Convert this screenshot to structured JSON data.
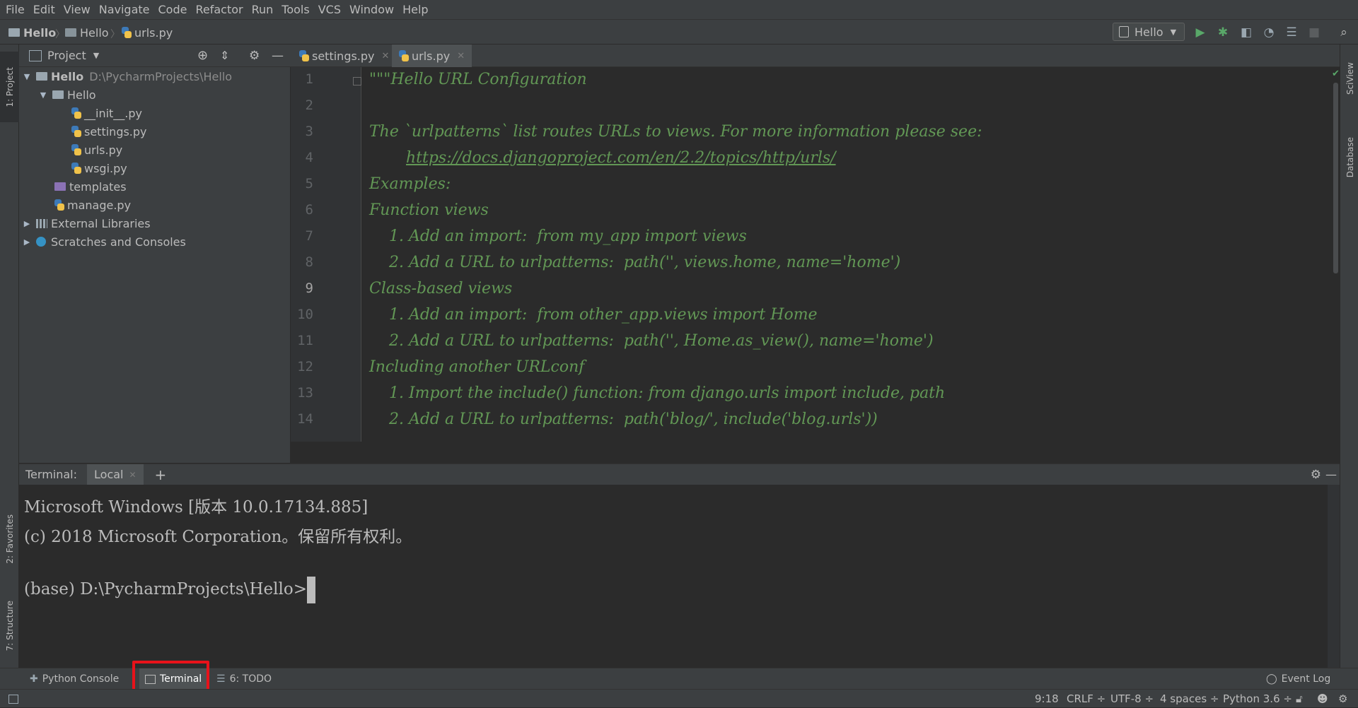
{
  "menu": [
    "File",
    "Edit",
    "View",
    "Navigate",
    "Code",
    "Refactor",
    "Run",
    "Tools",
    "VCS",
    "Window",
    "Help"
  ],
  "breadcrumb": {
    "project": "Hello",
    "folder": "Hello",
    "file": "urls.py"
  },
  "toolbar": {
    "run_config": "Hello"
  },
  "left_stripe": {
    "project": "1: Project",
    "favorites": "2: Favorites",
    "structure": "7: Structure"
  },
  "right_stripe": {
    "sciview": "SciView",
    "database": "Database"
  },
  "project_panel": {
    "title": "Project",
    "root": {
      "name": "Hello",
      "path": "D:\\PycharmProjects\\Hello"
    },
    "package": "Hello",
    "files": [
      "__init__.py",
      "settings.py",
      "urls.py",
      "wsgi.py"
    ],
    "templates": "templates",
    "manage": "manage.py",
    "external": "External Libraries",
    "scratches": "Scratches and Consoles"
  },
  "editor": {
    "tabs": [
      {
        "label": "settings.py"
      },
      {
        "label": "urls.py"
      }
    ],
    "line_numbers": [
      "1",
      "2",
      "3",
      "4",
      "5",
      "6",
      "7",
      "8",
      "9",
      "10",
      "11",
      "12",
      "13",
      "14"
    ],
    "lines": [
      "\"\"\"Hello URL Configuration",
      "",
      "The `urlpatterns` list routes URLs to views. For more information please see:",
      "https://docs.djangoproject.com/en/2.2/topics/http/urls/",
      "Examples:",
      "Function views",
      "    1. Add an import:  from my_app import views",
      "    2. Add a URL to urlpatterns:  path('', views.home, name='home')",
      "Class-based views",
      "    1. Add an import:  from other_app.views import Home",
      "    2. Add a URL to urlpatterns:  path('', Home.as_view(), name='home')",
      "Including another URLconf",
      "    1. Import the include() function: from django.urls import include, path",
      "    2. Add a URL to urlpatterns:  path('blog/', include('blog.urls'))"
    ]
  },
  "terminal": {
    "label": "Terminal:",
    "tab": "Local",
    "lines": [
      "Microsoft Windows [版本 10.0.17134.885]",
      "(c) 2018 Microsoft Corporation。保留所有权利。",
      ""
    ],
    "prompt": "(base) D:\\PycharmProjects\\Hello>"
  },
  "bottom_tabs": {
    "python_console": "Python Console",
    "terminal": "Terminal",
    "todo": "6: TODO",
    "event_log": "Event Log"
  },
  "status": {
    "position": "9:18",
    "line_sep": "CRLF ÷",
    "encoding": "UTF-8 ÷",
    "indent": "4 spaces ÷",
    "interpreter": "Python 3.6 ÷"
  },
  "colors": {
    "highlight": "#e8121a",
    "comment": "#629755",
    "accent": "#4a88c7"
  }
}
